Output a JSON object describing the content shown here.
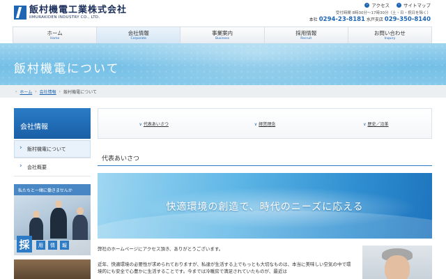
{
  "header": {
    "company_ja": "飯村機電工業株式会社",
    "company_en": "IIMURAKIDEN INDUSTRY CO., LTD.",
    "links": [
      {
        "icon": "chevron-right-icon",
        "label": "アクセス"
      },
      {
        "icon": "chevron-right-icon",
        "label": "サイトマップ"
      }
    ],
    "hours": "受付時間 8時30分〜17時30分（土・日・祝日を除く）",
    "head_office_label": "本社",
    "head_office_tel": "0294-23-8181",
    "branch_label": "水戸支店",
    "branch_tel": "029-350-8140"
  },
  "nav": [
    {
      "ja": "ホーム",
      "en": "Home"
    },
    {
      "ja": "会社情報",
      "en": "Corporate"
    },
    {
      "ja": "事業案内",
      "en": "Business"
    },
    {
      "ja": "採用情報",
      "en": "Recruit"
    },
    {
      "ja": "お問い合わせ",
      "en": "Inquiry"
    }
  ],
  "banner": {
    "title": "飯村機電について"
  },
  "breadcrumb": [
    "ホーム",
    "会社情報",
    "飯村機電について"
  ],
  "sidebar": {
    "title": "会社情報",
    "items": [
      {
        "label": "飯村機電について"
      },
      {
        "label": "会社概要"
      }
    ],
    "recruit": {
      "tagline": "私たちと一緒に働きませんか",
      "big_char": "採",
      "chars": [
        "用",
        "情",
        "報"
      ]
    }
  },
  "anchors": [
    "代表あいさつ",
    "経営理念",
    "歴史／沿革"
  ],
  "section": {
    "title": "代表あいさつ"
  },
  "hero": {
    "text": "快適環境の創造で、時代のニーズに応える"
  },
  "body": {
    "para1": "弊社のホームページにアクセス頂き、ありがとうございます。",
    "para2": "近年、快適環境の必要性が求められておりますが、私達が生活する上でもっとも大切なものは、本当に美味しい空気の中で環境的にも安全で心豊かに生活することです。今までは冷暖房で満足されていたものが、最近は"
  },
  "colors": {
    "brand": "#1e66b4",
    "banner": "#74bfe6"
  }
}
